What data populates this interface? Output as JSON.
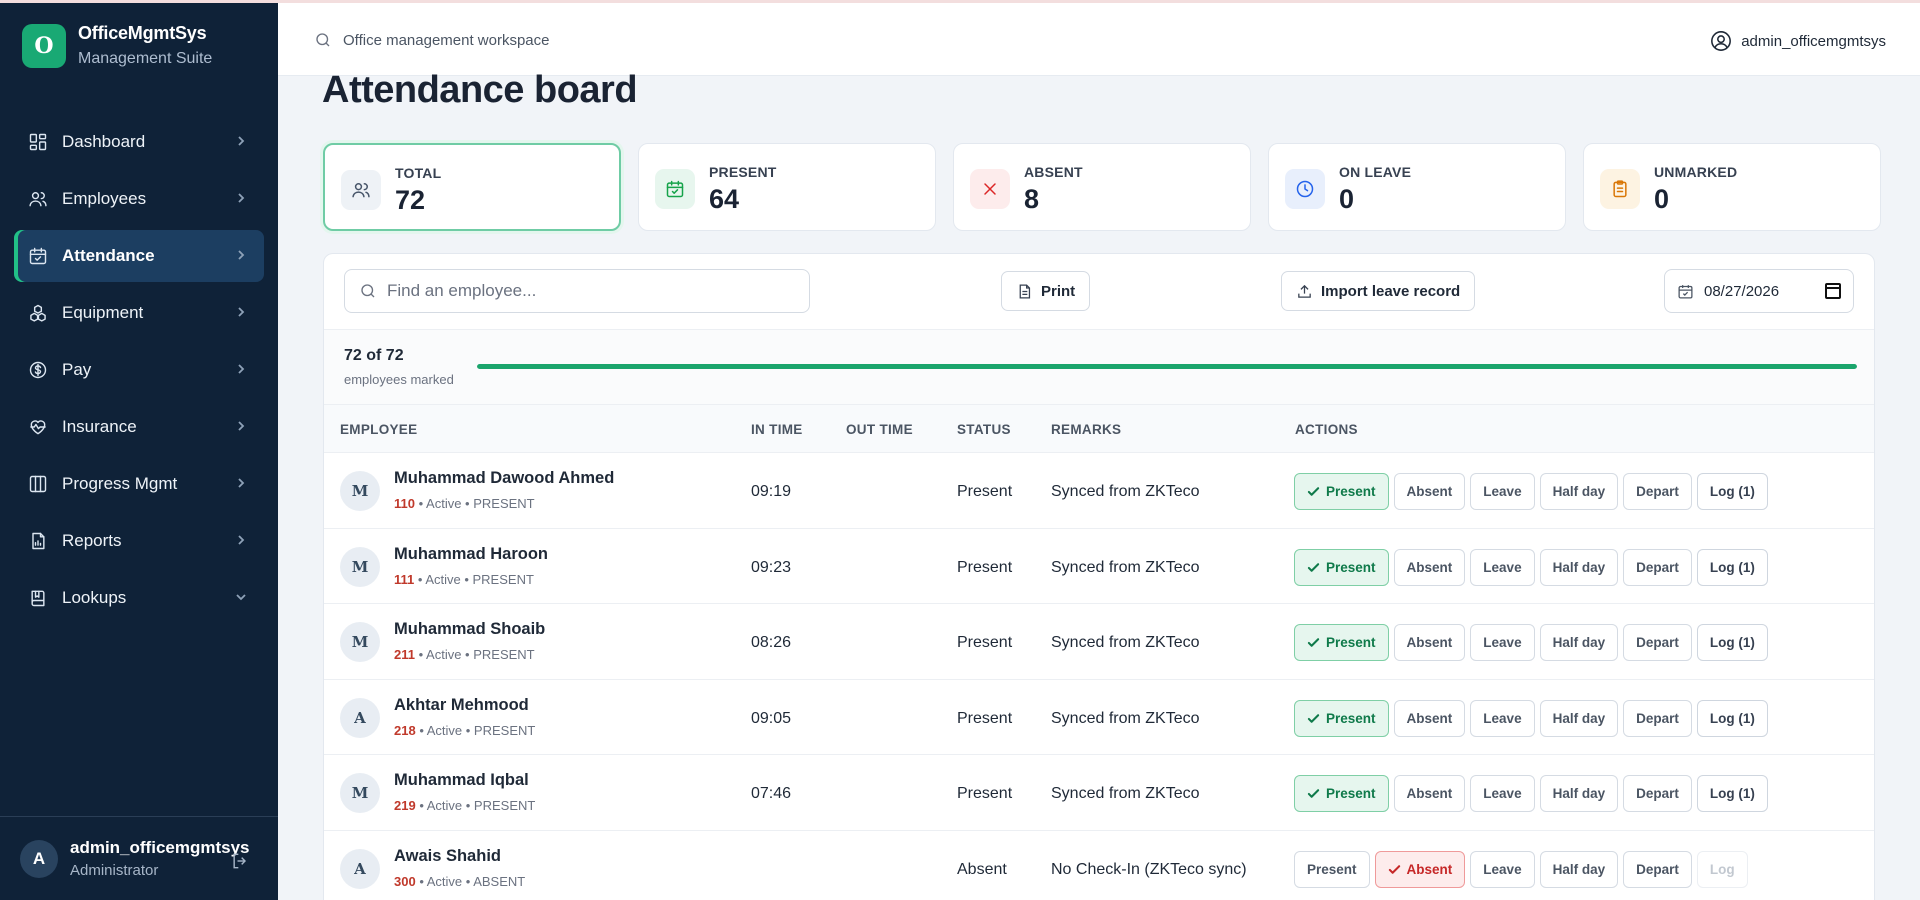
{
  "brand": {
    "logo_letter": "O",
    "name": "OfficeMgmtSys",
    "subtitle": "Management Suite"
  },
  "sidebar": {
    "items": [
      {
        "label": "Dashboard",
        "icon": "dashboard-icon",
        "active": false,
        "chevron": "right"
      },
      {
        "label": "Employees",
        "icon": "users-icon",
        "active": false,
        "chevron": "right"
      },
      {
        "label": "Attendance",
        "icon": "calendar-check-icon",
        "active": true,
        "chevron": "right"
      },
      {
        "label": "Equipment",
        "icon": "boxes-icon",
        "active": false,
        "chevron": "right"
      },
      {
        "label": "Pay",
        "icon": "dollar-circle-icon",
        "active": false,
        "chevron": "right"
      },
      {
        "label": "Insurance",
        "icon": "heart-pulse-icon",
        "active": false,
        "chevron": "right"
      },
      {
        "label": "Progress Mgmt",
        "icon": "columns-icon",
        "active": false,
        "chevron": "right"
      },
      {
        "label": "Reports",
        "icon": "report-icon",
        "active": false,
        "chevron": "right"
      },
      {
        "label": "Lookups",
        "icon": "book-icon",
        "active": false,
        "chevron": "down"
      }
    ],
    "user": {
      "initial": "A",
      "name": "admin_officemgmtsys",
      "role": "Administrator"
    }
  },
  "topbar": {
    "search_text": "Office management workspace",
    "username": "admin_officemgmtsys"
  },
  "page": {
    "title": "Attendance board"
  },
  "stats": [
    {
      "label": "TOTAL",
      "value": "72",
      "icon": "users-icon",
      "color": "#475569",
      "bg": "#eef2f6",
      "selected": true
    },
    {
      "label": "PRESENT",
      "value": "64",
      "icon": "calendar-check-icon",
      "color": "#16a34a",
      "bg": "#e7f6ee",
      "selected": false
    },
    {
      "label": "ABSENT",
      "value": "8",
      "icon": "x-icon",
      "color": "#dc2626",
      "bg": "#fdecec",
      "selected": false
    },
    {
      "label": "ON LEAVE",
      "value": "0",
      "icon": "clock-icon",
      "color": "#2563eb",
      "bg": "#e8effc",
      "selected": false
    },
    {
      "label": "UNMARKED",
      "value": "0",
      "icon": "clipboard-icon",
      "color": "#d97706",
      "bg": "#fdf3e2",
      "selected": false
    }
  ],
  "toolbar": {
    "search_placeholder": "Find an employee...",
    "print_label": "Print",
    "import_label": "Import leave record",
    "date_value": "08/27/2026"
  },
  "progress": {
    "count_text": "72 of 72",
    "sub_text": "employees marked",
    "fraction": 1.0
  },
  "table": {
    "headers": {
      "employee": "EMPLOYEE",
      "in_time": "IN TIME",
      "out_time": "OUT TIME",
      "status": "STATUS",
      "remarks": "REMARKS",
      "actions": "ACTIONS"
    },
    "action_labels": [
      "Present",
      "Absent",
      "Leave",
      "Half day",
      "Depart"
    ],
    "rows": [
      {
        "initial": "M",
        "name": "Muhammad Dawood Ahmed",
        "code": "110",
        "meta": " • Active • PRESENT",
        "in_time": "09:19",
        "out_time": "",
        "status": "Present",
        "remarks": "Synced from ZKTeco",
        "active_action": "Present",
        "log_label": "Log (1)",
        "log_enabled": true
      },
      {
        "initial": "M",
        "name": "Muhammad Haroon",
        "code": "111",
        "meta": " • Active • PRESENT",
        "in_time": "09:23",
        "out_time": "",
        "status": "Present",
        "remarks": "Synced from ZKTeco",
        "active_action": "Present",
        "log_label": "Log (1)",
        "log_enabled": true
      },
      {
        "initial": "M",
        "name": "Muhammad Shoaib",
        "code": "211",
        "meta": " • Active • PRESENT",
        "in_time": "08:26",
        "out_time": "",
        "status": "Present",
        "remarks": "Synced from ZKTeco",
        "active_action": "Present",
        "log_label": "Log (1)",
        "log_enabled": true
      },
      {
        "initial": "A",
        "name": "Akhtar Mehmood",
        "code": "218",
        "meta": " • Active • PRESENT",
        "in_time": "09:05",
        "out_time": "",
        "status": "Present",
        "remarks": "Synced from ZKTeco",
        "active_action": "Present",
        "log_label": "Log (1)",
        "log_enabled": true
      },
      {
        "initial": "M",
        "name": "Muhammad Iqbal",
        "code": "219",
        "meta": " • Active • PRESENT",
        "in_time": "07:46",
        "out_time": "",
        "status": "Present",
        "remarks": "Synced from ZKTeco",
        "active_action": "Present",
        "log_label": "Log (1)",
        "log_enabled": true
      },
      {
        "initial": "A",
        "name": "Awais Shahid",
        "code": "300",
        "meta": " • Active • ABSENT",
        "in_time": "",
        "out_time": "",
        "status": "Absent",
        "remarks": "No Check-In (ZKTeco sync)",
        "active_action": "Absent",
        "log_label": "Log",
        "log_enabled": false
      }
    ]
  }
}
